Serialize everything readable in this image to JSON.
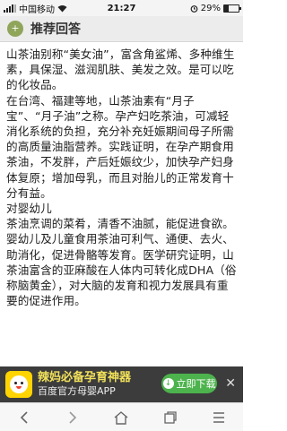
{
  "status_bar": {
    "carrier": "中国移动",
    "time": "21:27",
    "battery_percent": "29%",
    "battery_level": 0.29
  },
  "header": {
    "badge_icon": "+",
    "title": "推荐回答"
  },
  "answer": {
    "paragraphs": [
      "山茶油别称“美女油”，富含角鲨烯、多种维生素，具保湿、滋润肌肤、美发之效。是可以吃的化妆品。",
      "在台湾、福建等地，山茶油素有“月子宝”、“月子油”之称。孕产妇吃茶油，可减轻消化系统的负担，充分补充妊娠期间母子所需的高质量油脂营养。实践证明，在孕产期食用茶油，不发胖，产后妊娠纹少，加快孕产妇身体复原；增加母乳，而且对胎儿的正常发育十分有益。",
      "对婴幼儿",
      "茶油烹调的菜肴，清香不油腻，能促进食欲。婴幼儿及儿童食用茶油可利气、通便、去火、助消化，促进骨骼等发育。医学研究证明，山茶油富含的亚麻酸在人体内可转化成DHA（俗称脑黄金），对大脑的发育和视力发展具有重要的促进作用。"
    ]
  },
  "ad": {
    "title": "辣妈必备孕育神器",
    "subtitle": "百度官方母婴APP",
    "download_label": "立即下载",
    "close_label": "✕"
  },
  "navbar": {
    "icons": [
      "back-icon",
      "forward-icon",
      "home-icon",
      "tabs-icon",
      "menu-icon"
    ]
  }
}
